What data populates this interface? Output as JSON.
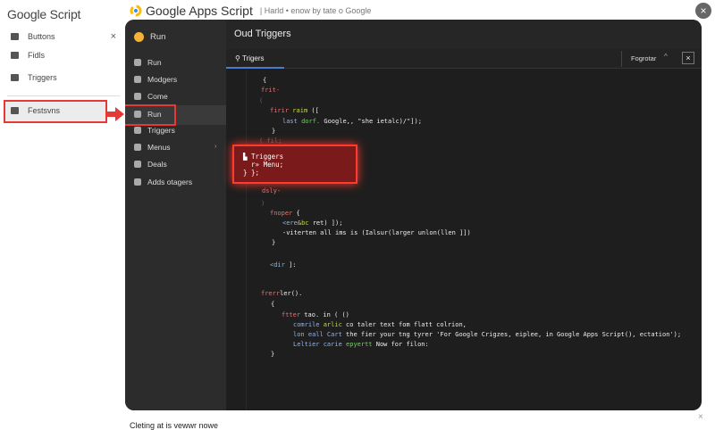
{
  "left_sidebar": {
    "logo": "Google Script",
    "items": [
      {
        "label": "Buttons",
        "icon": "home-icon"
      },
      {
        "label": "Fidls",
        "icon": "file-icon"
      },
      {
        "label": "Triggers",
        "icon": "trigger-icon"
      }
    ],
    "highlighted": {
      "label": "Festsvns",
      "icon": "home-icon"
    }
  },
  "header": {
    "title": "Google Apps Script",
    "subtitle": "| Harld • enow by tate o Google"
  },
  "nav": {
    "header": "Run",
    "items": [
      {
        "label": "Run"
      },
      {
        "label": "Modgers"
      },
      {
        "label": "Come"
      },
      {
        "label": "Run"
      },
      {
        "label": "Triggers"
      },
      {
        "label": "Menus"
      },
      {
        "label": "Deals"
      },
      {
        "label": "Adds otagers"
      }
    ]
  },
  "main": {
    "title": "Oud Triggers",
    "tab": "Trigers",
    "find_label": "Fogrotar"
  },
  "code": [
    [
      [
        "{",
        "st"
      ]
    ],
    [
      [
        "frit-",
        "kw"
      ]
    ],
    [
      [
        "(",
        "dim"
      ]
    ],
    [
      [
        "firir ",
        "kw"
      ],
      [
        "raim ",
        "fn"
      ],
      [
        "([",
        "st"
      ]
    ],
    [
      [
        "last ",
        "bl"
      ],
      [
        "dorf. ",
        "gr"
      ],
      [
        "Google,, \"she ietalc)/\"]);",
        "st"
      ]
    ],
    [
      [
        "}",
        "st"
      ]
    ],
    [
      [
        "( fil;",
        "dim"
      ]
    ],
    [
      [
        "dsly-",
        "kw"
      ]
    ],
    [
      [
        ")",
        "dim"
      ]
    ],
    [
      [
        "fnoper ",
        "kw"
      ],
      [
        "{",
        "st"
      ]
    ],
    [
      [
        "<ere",
        "bl"
      ],
      [
        "&bc ",
        "fn"
      ],
      [
        "ret) ]);",
        "st"
      ]
    ],
    [
      [
        "-viterten all ims is (Ialsur(larger unlon(llen ]])",
        "st"
      ]
    ],
    [
      [
        "}",
        "st"
      ]
    ],
    [
      [
        "<dir ",
        "bl"
      ],
      [
        "]:",
        "st"
      ]
    ],
    [
      [
        "frerr",
        "kw"
      ],
      [
        "ler().",
        "st"
      ]
    ],
    [
      [
        "{",
        "st"
      ]
    ],
    [
      [
        "ftter ",
        "kw"
      ],
      [
        "tao. in ( ()",
        "st"
      ]
    ],
    [
      [
        "comrile ",
        "bl"
      ],
      [
        "arlic ",
        "fn"
      ],
      [
        "co taler text fom flatt colrion,",
        "st"
      ]
    ],
    [
      [
        "lon eall Cart ",
        "bl"
      ],
      [
        "the fier your tng tyrer 'For Google Crigzes, eiplee, in Google Apps Script(), ectation');",
        "st"
      ]
    ],
    [
      [
        "Leltier carie ",
        "bl"
      ],
      [
        "epyertt ",
        "gr"
      ],
      [
        "Now for filon:",
        "st"
      ]
    ],
    [
      [
        "}",
        "st"
      ]
    ]
  ],
  "popup": {
    "line1": "Triggers",
    "line2": "  r» Menu;",
    "line3": "} };"
  },
  "footer": {
    "text": "Cleting at is vewwr nowe"
  },
  "colors": {
    "highlight": "#e53935",
    "panel": "#1e1e1e",
    "tab_underline": "#4a7bd0"
  }
}
